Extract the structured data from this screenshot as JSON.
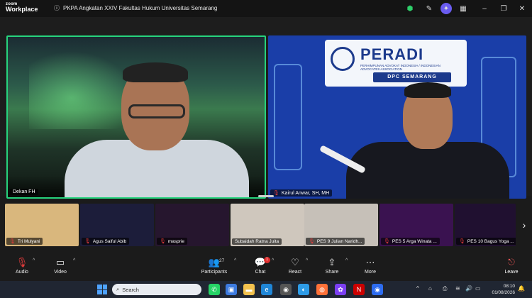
{
  "app": {
    "brand_top": "zoom",
    "brand_bottom": "Workplace",
    "window_title": "PKPA Angkatan XXIV Fakultas Hukum Universitas Semarang"
  },
  "stage": {
    "left_name": "Dekan FH",
    "right_name": "Kairul Anwar, SH, MH",
    "banner_title": "PERADI",
    "banner_sub": "PERHIMPUNAN ADVOKAT INDONESIA / INDONESIAN ADVOCATES ASSOCIATION",
    "banner_dpc": "DPC SEMARANG"
  },
  "filmstrip": [
    {
      "name": "Tri Mulyani",
      "bg": "#d9b77d"
    },
    {
      "name": "Agus Saiful Abib",
      "bg": "#1c1d3a"
    },
    {
      "name": "masprie",
      "bg": "#26162e"
    },
    {
      "name": "Subaidah Ratna Juita",
      "bg": "#cfc7bd"
    },
    {
      "name": "PES 9 Julian Naridh...",
      "bg": "#c6c0b8"
    },
    {
      "name": "PES 5 Arga Winata ...",
      "bg": "#3a1250"
    },
    {
      "name": "PES 10 Bagus Yoga ...",
      "bg": "#201030"
    }
  ],
  "toolbar": {
    "audio": "Audio",
    "video": "Video",
    "participants": "Participants",
    "participants_count": "27",
    "chat": "Chat",
    "chat_badge": "1",
    "react": "React",
    "share": "Share",
    "more": "More",
    "leave": "Leave"
  },
  "taskbar": {
    "search_placeholder": "Search",
    "time": "08:10",
    "date": "01/08/2026"
  },
  "colors": {
    "active_speaker": "#27d37d",
    "peradi_blue": "#1c3a8c",
    "leave_red": "#ff5b5b"
  }
}
